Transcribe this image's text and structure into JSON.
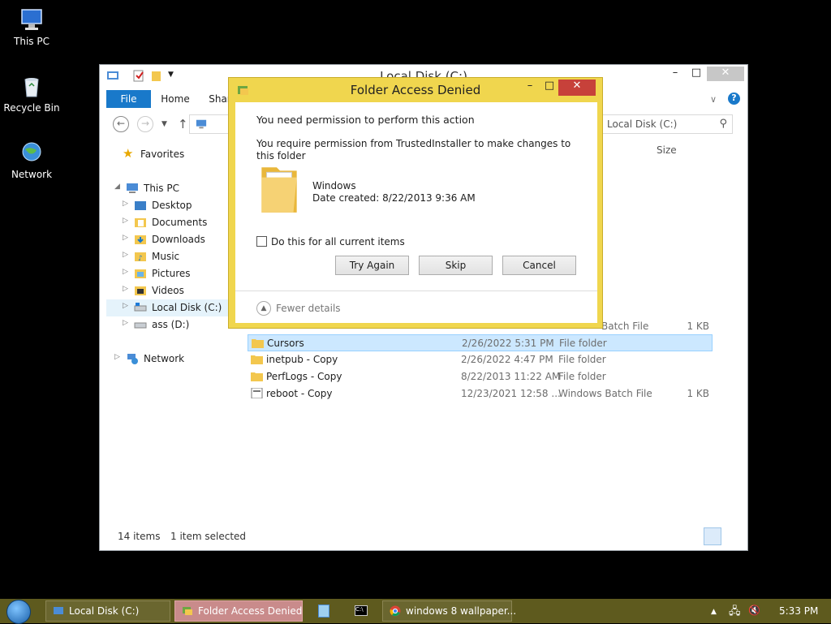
{
  "desktop": {
    "icons": [
      {
        "label": "This PC"
      },
      {
        "label": "Recycle Bin"
      },
      {
        "label": "Network"
      }
    ]
  },
  "explorer": {
    "title": "Local Disk (C:)",
    "ribbon_tabs": [
      "File",
      "Home",
      "Shar"
    ],
    "search_placeholder": "Local Disk (C:)",
    "columns": {
      "size": "Size"
    },
    "nav": {
      "favorites": "Favorites",
      "this_pc": "This PC",
      "items": [
        "Desktop",
        "Documents",
        "Downloads",
        "Music",
        "Pictures",
        "Videos",
        "Local Disk (C:)",
        "ass (D:)"
      ],
      "network": "Network"
    },
    "files": [
      {
        "name": "",
        "date": "",
        "type": "Batch File",
        "size": "1 KB"
      },
      {
        "name": "Cursors",
        "date": "2/26/2022 5:31 PM",
        "type": "File folder",
        "size": ""
      },
      {
        "name": "inetpub - Copy",
        "date": "2/26/2022 4:47 PM",
        "type": "File folder",
        "size": ""
      },
      {
        "name": "PerfLogs - Copy",
        "date": "8/22/2013 11:22 AM",
        "type": "File folder",
        "size": ""
      },
      {
        "name": "reboot - Copy",
        "date": "12/23/2021 12:58 ...",
        "type": "Windows Batch File",
        "size": "1 KB"
      }
    ],
    "status": {
      "count": "14 items",
      "selected": "1 item selected"
    }
  },
  "dialog": {
    "title": "Folder Access Denied",
    "heading": "You need permission to perform this action",
    "message": "You require permission from TrustedInstaller to make changes to this folder",
    "folder_name": "Windows",
    "date_created": "Date created: 8/22/2013 9:36 AM",
    "checkbox_label": "Do this for all current items",
    "buttons": {
      "try_again": "Try Again",
      "skip": "Skip",
      "cancel": "Cancel"
    },
    "fewer_details": "Fewer details",
    "controls": {
      "minimize": "–",
      "maximize": "□",
      "close": "✕"
    }
  },
  "taskbar": {
    "buttons": [
      {
        "label": "Local Disk (C:)"
      },
      {
        "label": "Folder Access Denied"
      },
      {
        "label": "windows 8 wallpaper..."
      }
    ],
    "clock": "5:33 PM"
  },
  "colors": {
    "accent": "#1979ca",
    "dialog_frame": "#f0d64e",
    "taskbar": "#5e5a1e",
    "close": "#c7413a"
  }
}
